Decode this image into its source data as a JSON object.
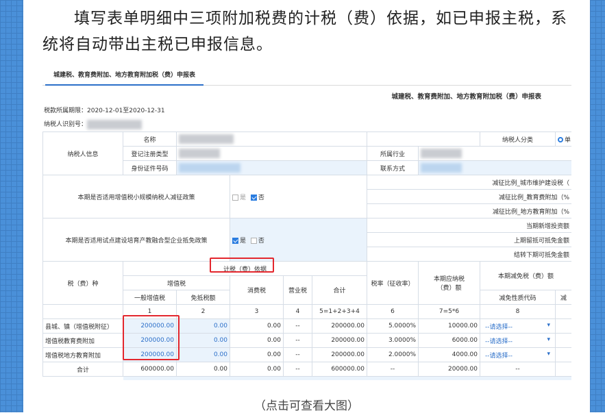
{
  "intro": "填写表单明细中三项附加税费的计税（费）依据，如已申报主税，系统将自动带出主税已申报信息。",
  "caption": "（点击可查看大图）",
  "tab": "城建税、教育费附加、地方教育附加税（费）申报表",
  "form_title": "城建税、教育费附加、地方教育附加税（费）申报表",
  "period": "税款所属期限：2020-12-01至2020-12-31",
  "taxpayer_id_label": "纳税人识别号：",
  "info": {
    "section": "纳税人信息",
    "name": "名称",
    "reg_type": "登记注册类型",
    "id_no": "身份证件号码",
    "category": "纳税人分类",
    "category_opt": "单",
    "industry": "所属行业",
    "contact": "联系方式"
  },
  "policy1": {
    "label": "本期是否适用增值税小规模纳税人减征政策",
    "yes": "是",
    "no": "否",
    "r1": "减征比例_城市维护建设税（",
    "r2": "减征比例_教育费附加（%",
    "r3": "减征比例_地方教育附加（%"
  },
  "policy2": {
    "label": "本期是否适用试点建设培育产教融合型企业抵免政策",
    "yes": "是",
    "no": "否",
    "r1": "当期新增投资额",
    "r2": "上期留抵可抵免金额",
    "r3": "结转下期可抵免金额"
  },
  "head": {
    "tax_type": "税（费）种",
    "basis": "计税（费）依据",
    "vat": "增值税",
    "general_vat": "一般增值税",
    "exempt_vat": "免抵税额",
    "consumption": "消费税",
    "business": "营业税",
    "total": "合计",
    "rate": "税率（征收率）",
    "payable1": "本期应纳税",
    "payable2": "（费）额",
    "relief": "本期减免税（费）额",
    "relief_code": "减免性质代码",
    "relief_amt": "减"
  },
  "colnums": [
    "1",
    "2",
    "3",
    "4",
    "5=1+2+3+4",
    "6",
    "7=5*6",
    "8"
  ],
  "rows": [
    {
      "name": "县城、镇（增值税附征）",
      "v1": "200000.00",
      "v2": "0.00",
      "v3": "0.00",
      "v4": "--",
      "v5": "200000.00",
      "v6": "5.0000%",
      "v7": "10000.00",
      "v8": "--请选择--"
    },
    {
      "name": "增值税教育费附加",
      "v1": "200000.00",
      "v2": "0.00",
      "v3": "0.00",
      "v4": "--",
      "v5": "200000.00",
      "v6": "3.0000%",
      "v7": "6000.00",
      "v8": "--请选择--"
    },
    {
      "name": "增值税地方教育附加",
      "v1": "200000.00",
      "v2": "0.00",
      "v3": "0.00",
      "v4": "--",
      "v5": "200000.00",
      "v6": "2.0000%",
      "v7": "4000.00",
      "v8": "--请选择--"
    }
  ],
  "total_row": {
    "name": "合计",
    "v1": "600000.00",
    "v2": "0.00",
    "v3": "0.00",
    "v4": "--",
    "v5": "600000.00",
    "v6": "--",
    "v7": "20000.00",
    "v8": "--"
  }
}
